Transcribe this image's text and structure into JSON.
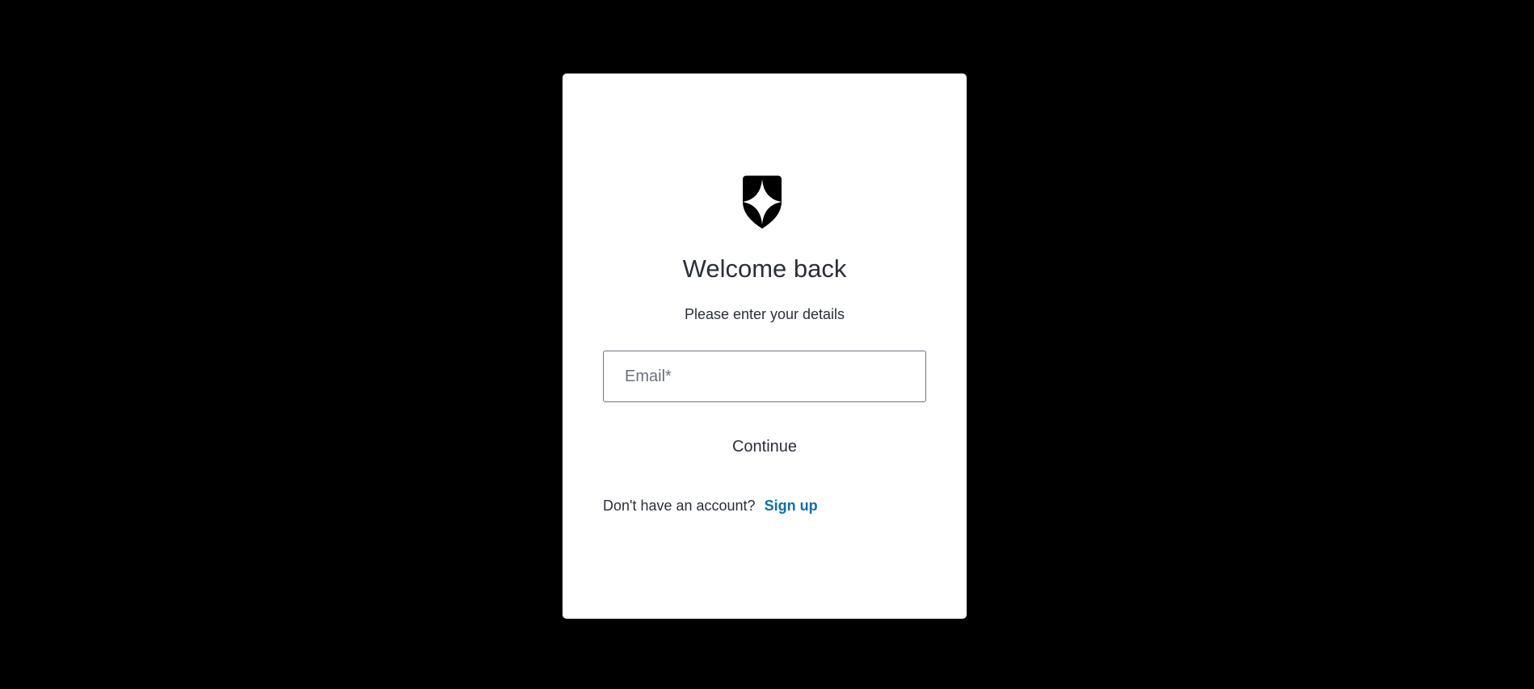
{
  "logo": {
    "icon": "shield-star-icon"
  },
  "login": {
    "title": "Welcome back",
    "subtitle": "Please enter your details",
    "email_placeholder": "Email*",
    "email_value": "",
    "continue_label": "Continue",
    "no_account_text": "Don't have an account?",
    "signup_label": "Sign up"
  },
  "colors": {
    "background": "#000000",
    "card": "#ffffff",
    "text": "#2b2f38",
    "link": "#0b6fa8"
  }
}
